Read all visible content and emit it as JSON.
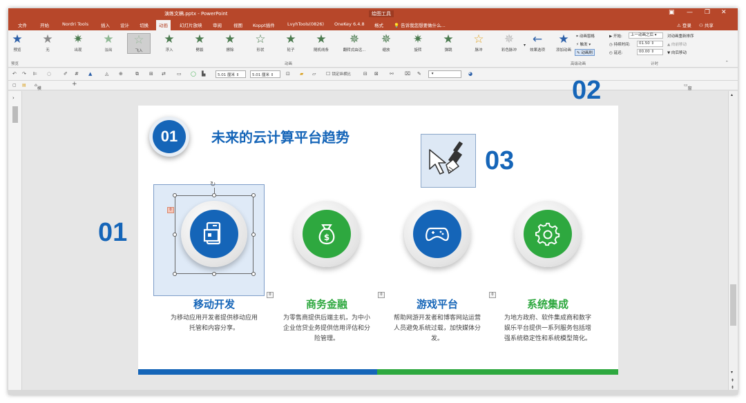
{
  "window": {
    "title": "演练文稿.pptx - PowerPoint",
    "context_tab": "绘图工具"
  },
  "tabs": [
    {
      "label": "文件"
    },
    {
      "label": "开始"
    },
    {
      "label": "Nordri Tools"
    },
    {
      "label": "插入"
    },
    {
      "label": "设计"
    },
    {
      "label": "切换"
    },
    {
      "label": "动画"
    },
    {
      "label": "幻灯片放映"
    },
    {
      "label": "审阅"
    },
    {
      "label": "视图"
    },
    {
      "label": "Koppt插件"
    },
    {
      "label": "LvyhTools(0826)"
    },
    {
      "label": "OneKey 6.4.8"
    },
    {
      "label": "格式"
    }
  ],
  "tell_me": "告诉我您想要做什么...",
  "account": {
    "login": "登录",
    "share": "共享"
  },
  "ribbon": {
    "preview": "预览",
    "preview_group": "预览",
    "animations": [
      {
        "label": "无"
      },
      {
        "label": "出现"
      },
      {
        "label": "淡出"
      },
      {
        "label": "飞入"
      },
      {
        "label": "浮入"
      },
      {
        "label": "劈裂"
      },
      {
        "label": "擦除"
      },
      {
        "label": "形状"
      },
      {
        "label": "轮子"
      },
      {
        "label": "随机线条"
      },
      {
        "label": "翻转式由远..."
      },
      {
        "label": "缩放"
      },
      {
        "label": "旋转"
      },
      {
        "label": "弹跳"
      },
      {
        "label": "脉冲"
      },
      {
        "label": "彩色脉冲"
      }
    ],
    "anim_group": "动画",
    "effect_options": "效果选项",
    "add_animation": "添加动画",
    "anim_pane": "动画窗格",
    "trigger": "触发",
    "anim_painter": "动画刷",
    "advanced_group": "高级动画",
    "start_label": "开始:",
    "start_value": "上一动画之后",
    "duration_label": "持续时间:",
    "duration_value": "01.50",
    "delay_label": "延迟:",
    "delay_value": "00.00",
    "reorder": "对动画重新排序",
    "move_earlier": "向前移动",
    "move_later": "向后移动",
    "timing_group": "计时"
  },
  "toolbar": {
    "width1": "5.01 厘米",
    "width2": "5.01 厘米",
    "lock_ratio": "锁定纵横比"
  },
  "docstrip": {
    "template_tab": "模板专区",
    "add": "+",
    "window_merge": "窗口合并显示"
  },
  "overlay": {
    "label_01": "01",
    "label_02": "02",
    "label_03": "03"
  },
  "slide": {
    "badge": "01",
    "title": "未来的云计算平台趋势",
    "cards": [
      {
        "title": "移动开发",
        "desc": "为移动应用开发者提供移动应用托管和内容分享。",
        "color": "#1565b8",
        "tag": "0"
      },
      {
        "title": "商务金融",
        "desc": "为零售商提供后端主机，为中小企业信贷业务提供信用评估和分险管理。",
        "color": "#2ea83f",
        "tag": "0"
      },
      {
        "title": "游戏平台",
        "desc": "帮助网游开发者和博客网站运营人员避免系统过载，加快媒体分发。",
        "color": "#1565b8",
        "tag": "0"
      },
      {
        "title": "系统集成",
        "desc": "为地方政府、软件集成商和数字娱乐平台提供一系列服务包括增强系统稳定性和系统模型简化。",
        "color": "#2ea83f",
        "tag": "0"
      }
    ],
    "sel_tag": "0"
  },
  "colors": {
    "ribbon": "#b7472a",
    "blue": "#1565b8",
    "green": "#2ea83f"
  }
}
